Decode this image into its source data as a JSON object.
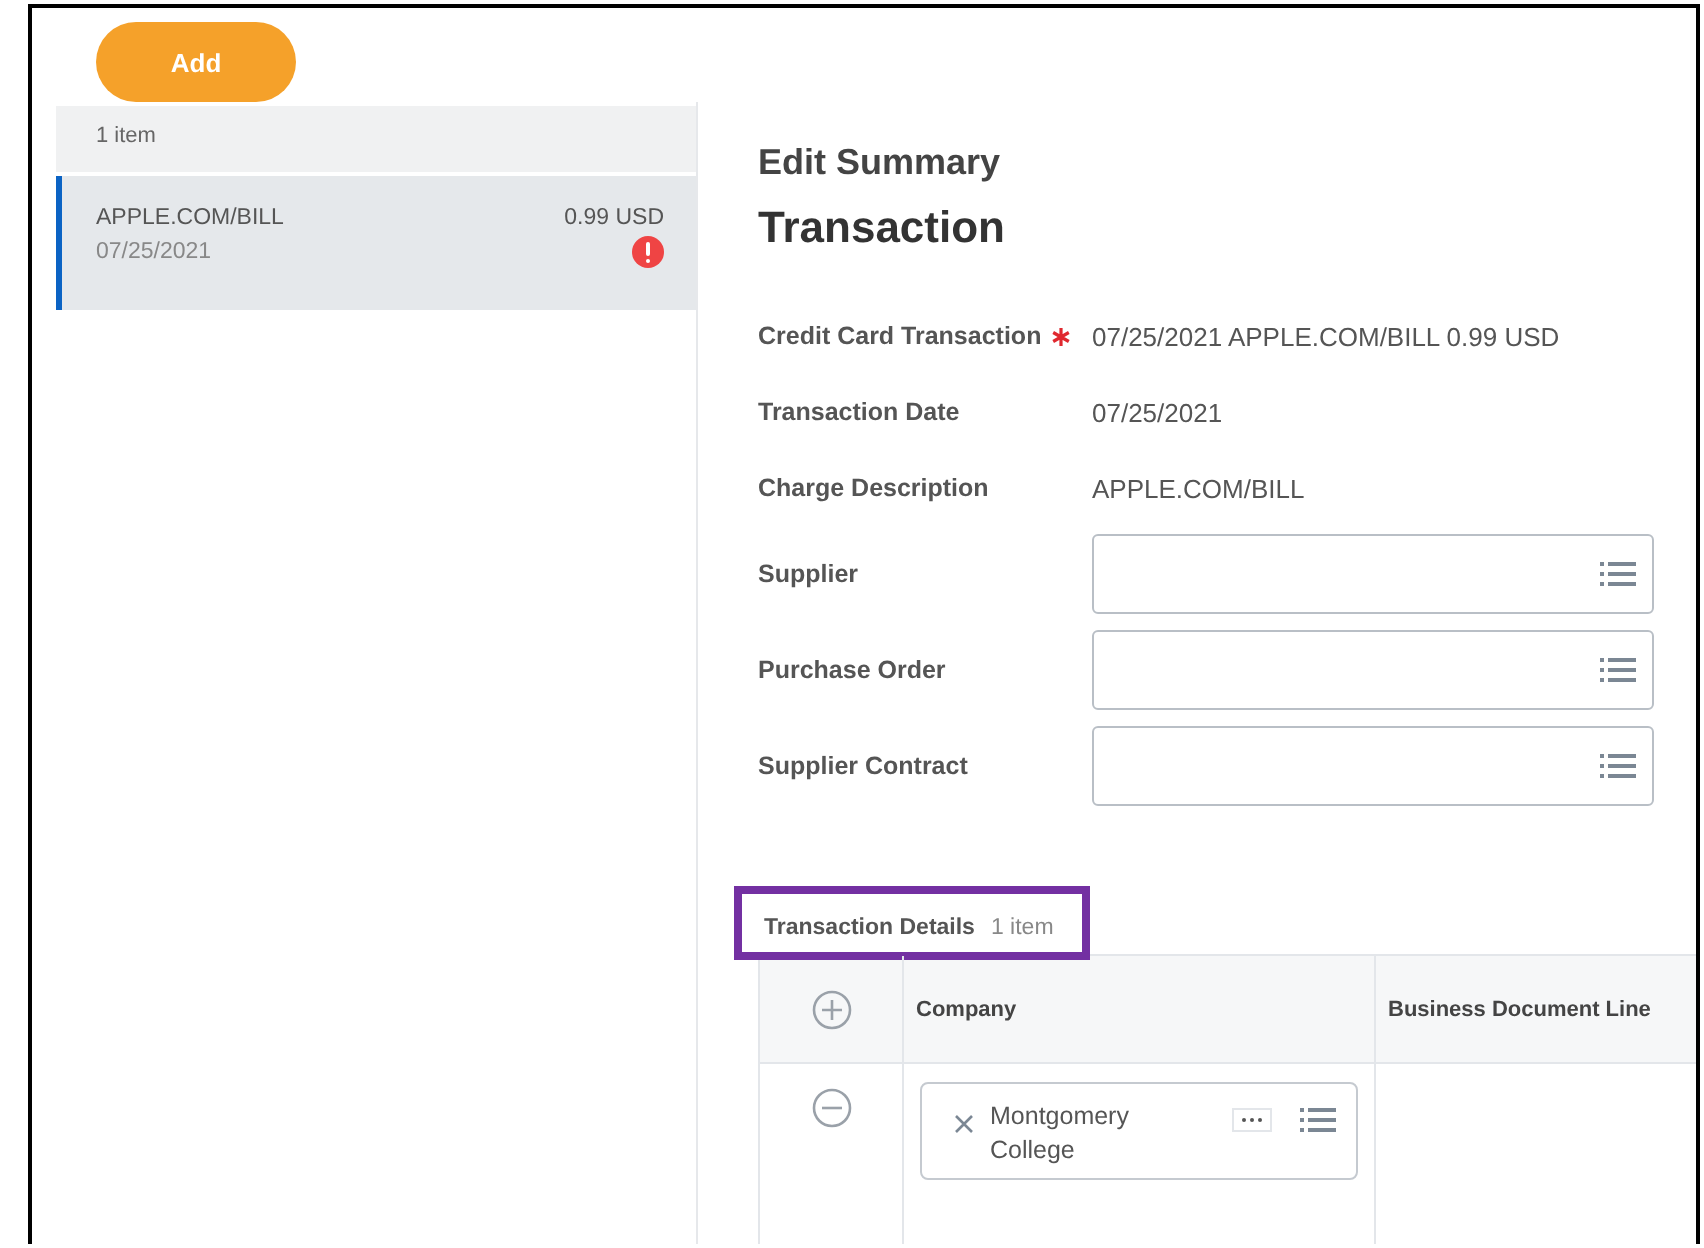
{
  "toolbar": {
    "add_button": "Add"
  },
  "list": {
    "count": "1 item",
    "items": [
      {
        "name": "APPLE.COM/BILL",
        "amount": "0.99 USD",
        "date": "07/25/2021",
        "selected": true,
        "error": true
      }
    ]
  },
  "editor": {
    "heading": "Edit Summary",
    "title": "Transaction",
    "fields": [
      {
        "kind": "text",
        "label": "Credit Card Transaction",
        "required": true,
        "value": "07/25/2021 APPLE.COM/BILL 0.99 USD"
      },
      {
        "kind": "text",
        "label": "Transaction Date",
        "required": false,
        "value": "07/25/2021"
      },
      {
        "kind": "text",
        "label": "Charge Description",
        "required": false,
        "value": "APPLE.COM/BILL"
      },
      {
        "kind": "lookup",
        "label": "Supplier",
        "required": false
      },
      {
        "kind": "lookup",
        "label": "Purchase Order",
        "required": false
      },
      {
        "kind": "lookup",
        "label": "Supplier Contract",
        "required": false
      }
    ],
    "details": {
      "title": "Transaction Details",
      "count": "1 item",
      "highlighted": true,
      "columns": [
        "Company",
        "Business Document Line"
      ],
      "rows": [
        {
          "company": "Montgomery College"
        }
      ]
    }
  }
}
